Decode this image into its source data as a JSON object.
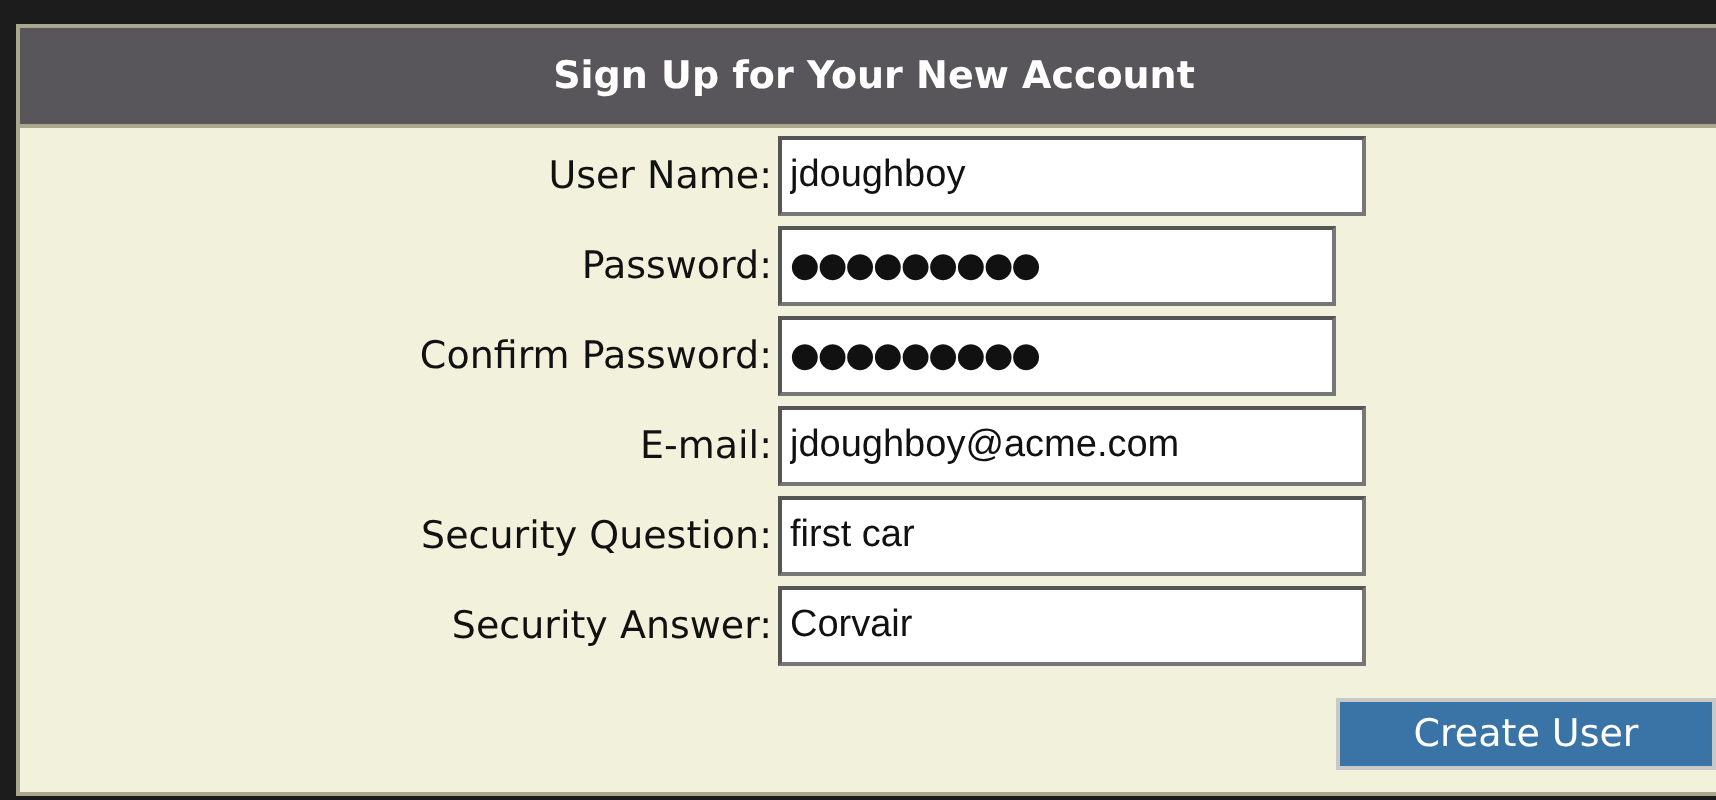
{
  "title": "Sign Up for Your New Account",
  "fields": [
    {
      "label": "User Name:",
      "kind": "text",
      "value": "jdoughboy"
    },
    {
      "label": "Password:",
      "kind": "password",
      "value": "●●●●●●●●●"
    },
    {
      "label": "Confirm Password:",
      "kind": "password",
      "value": "●●●●●●●●●"
    },
    {
      "label": "E-mail:",
      "kind": "text",
      "value": "jdoughboy@acme.com"
    },
    {
      "label": "Security Question:",
      "kind": "text",
      "value": "first car"
    },
    {
      "label": "Security Answer:",
      "kind": "text",
      "value": "Corvair"
    }
  ],
  "button": "Create User"
}
